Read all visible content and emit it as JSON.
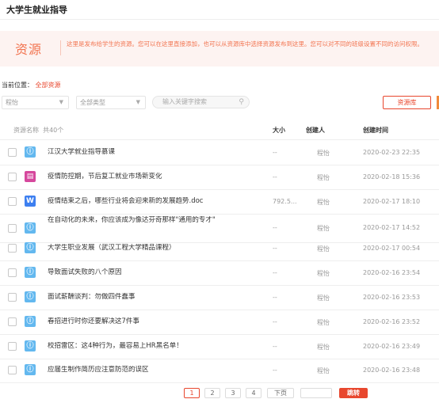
{
  "page": {
    "title": "大学生就业指导"
  },
  "banner": {
    "heading": "资源",
    "text": "这里是发布给学生的资源。您可以在这里直接添加，也可以从资源库中选择资源发布到这里。您可以对不同的班级设置不同的访问权限。"
  },
  "breadcrumb": {
    "label": "当前位置：",
    "current": "全部资源"
  },
  "filters": {
    "creator": "程怡",
    "type": "全部类型",
    "search_placeholder": "输入关键字搜索",
    "library_button": "资源库"
  },
  "table": {
    "headers": {
      "name": "资源名称",
      "count": "共40个",
      "size": "大小",
      "creator": "创建人",
      "time": "创建时间"
    },
    "rows": [
      {
        "icon": "link-icon",
        "name": "江汉大学就业指导慕课",
        "size": "--",
        "creator": "程怡",
        "time": "2020-02-23 22:35"
      },
      {
        "icon": "ppt-icon",
        "name": "疫情防控期，节后复工就业市场新变化",
        "size": "--",
        "creator": "程怡",
        "time": "2020-02-18 15:36"
      },
      {
        "icon": "word-doc-icon",
        "name": "疫情结束之后，哪些行业将会迎来新的发展趋势.doc",
        "size": "792.5...",
        "creator": "程怡",
        "time": "2020-02-17 18:10"
      },
      {
        "icon": "link-icon",
        "name": "在自动化的未来，你应该成为像达芬奇那样\"通用的专才\"",
        "size": "--",
        "creator": "程怡",
        "time": "2020-02-17 14:52"
      },
      {
        "icon": "link-icon",
        "name": "大学生职业发展（武汉工程大学精品课程）",
        "size": "--",
        "creator": "程怡",
        "time": "2020-02-17 00:54"
      },
      {
        "icon": "link-icon",
        "name": "导致面试失败的八个原因",
        "size": "--",
        "creator": "程怡",
        "time": "2020-02-16 23:54"
      },
      {
        "icon": "link-icon",
        "name": "面试薪酬谈判：勿做四件蠢事",
        "size": "--",
        "creator": "程怡",
        "time": "2020-02-16 23:53"
      },
      {
        "icon": "link-icon",
        "name": "春招进行时你还要解决这7件事",
        "size": "--",
        "creator": "程怡",
        "time": "2020-02-16 23:52"
      },
      {
        "icon": "link-icon",
        "name": "校招雷区：这4种行为，最容易上HR黑名单！",
        "size": "--",
        "creator": "程怡",
        "time": "2020-02-16 23:49"
      },
      {
        "icon": "link-icon",
        "name": "应届生制作简历应注意防范的误区",
        "size": "--",
        "creator": "程怡",
        "time": "2020-02-16 23:48"
      }
    ]
  },
  "pagination": {
    "pages": [
      "1",
      "2",
      "3",
      "4"
    ],
    "current": "1",
    "next_label": "下页",
    "jump_label": "跳转"
  },
  "colors": {
    "accent": "#e8472e",
    "banner_bg": "#fdf3f1",
    "banner_text": "#f2734f",
    "link_icon": "#63b8ef",
    "ppt_icon": "#d6489d",
    "doc_icon": "#3d7ff0"
  }
}
